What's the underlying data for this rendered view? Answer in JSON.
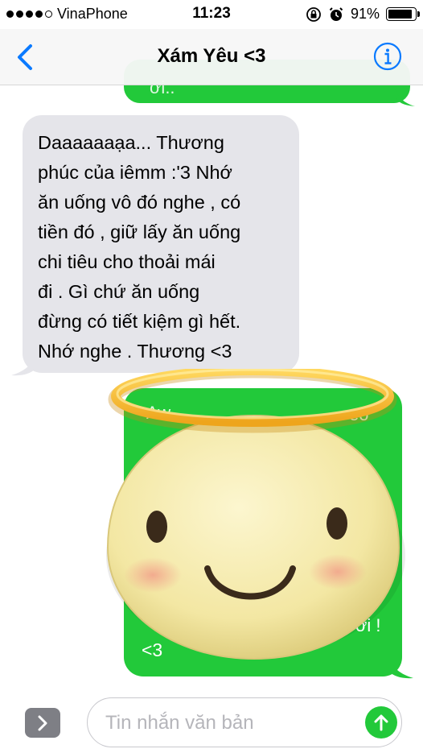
{
  "status_bar": {
    "carrier": "VinaPhone",
    "time": "11:23",
    "battery_percent": "91%",
    "battery_level": 0.91,
    "signal_bars_filled": 4,
    "signal_bars_total": 5,
    "icons": [
      "orientation-lock-icon",
      "alarm-icon",
      "battery-icon"
    ]
  },
  "nav": {
    "title": "Xám Yêu <3",
    "back_icon": "chevron-left-icon",
    "info_icon": "info-icon"
  },
  "messages": {
    "previous_outgoing_partial": "ơi..",
    "incoming_text": "Daaaaaaạa... Thương\nphúc của iêmm :'3  Nhớ\năn uống vô đó nghe , có\ntiền đó , giữ lấy ăn uống\nchi tiêu cho thoải mái\nđi . Gì chứ ăn uống\nđừng có tiết kiệm gì hết.\nNhớ nghe . Thương <3",
    "outgoing_visible_end": "<3",
    "outgoing_partial_top": "Aw",
    "outgoing_partial_top_right": "eo",
    "outgoing_partial_mid_right": "ơi !",
    "sticker": "angel-smiley-sticker"
  },
  "composer": {
    "placeholder": "Tin nhắn văn bản",
    "expand_icon": "chevron-right-icon",
    "send_icon": "arrow-up-icon"
  },
  "colors": {
    "accent_blue": "#0a7aff",
    "bubble_green": "#22c93a",
    "bubble_gray": "#e5e5ea",
    "halo_gold": "#f6b52a",
    "face": "#f6eba7"
  }
}
